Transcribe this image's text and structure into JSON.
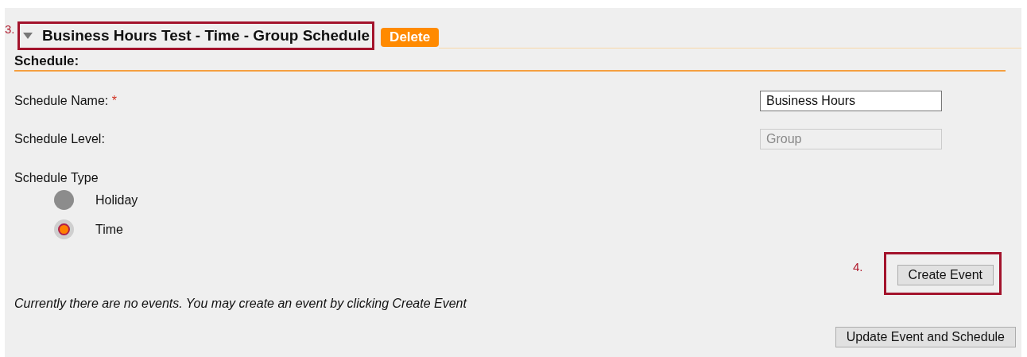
{
  "section": {
    "annotation": "3.",
    "title": "Business Hours Test - Time - Group Schedule",
    "expanded": true,
    "delete_button": "Delete"
  },
  "subheading": "Schedule:",
  "fields": [
    {
      "label": "Schedule Name:",
      "required_mark": "*",
      "value": "Business Hours",
      "disabled": false
    },
    {
      "label": "Schedule Level:",
      "value": "Group",
      "disabled": true
    }
  ],
  "schedule_type": {
    "label": "Schedule Type",
    "options": [
      {
        "label": "Holiday",
        "selected": false
      },
      {
        "label": "Time",
        "selected": true
      }
    ]
  },
  "create_event": {
    "annotation": "4.",
    "label": "Create Event"
  },
  "message": "Currently there are no events. You may create an event by clicking Create Event",
  "update_button": "Update Event and Schedule"
}
